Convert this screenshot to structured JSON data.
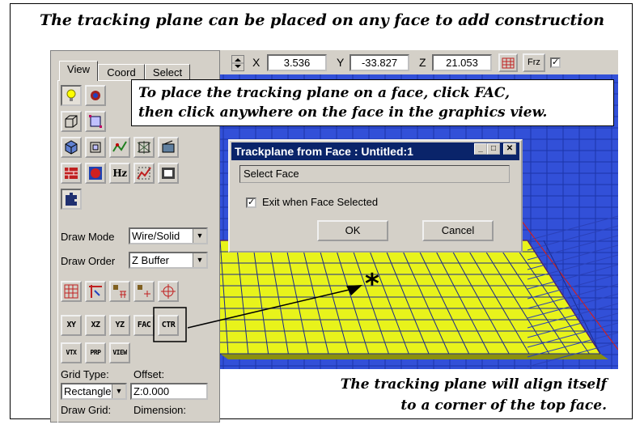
{
  "captions": {
    "top": "The tracking plane can be placed on any face to add construction",
    "callout_line1": "To place the tracking plane on a face, click FAC,",
    "callout_line2": "then click anywhere on the face in the graphics view.",
    "bottom_line1": "The tracking plane will align itself",
    "bottom_line2": "to a corner of the top face."
  },
  "panel": {
    "tabs": [
      "View",
      "Coord",
      "Select"
    ],
    "active_tab": "View",
    "icon_names": [
      "bulb-icon",
      "gear-ball-icon",
      "box-wire-icon",
      "box-select-icon",
      "cube-shaded-icon",
      "box-frame-icon",
      "curve-icon",
      "surface-icon",
      "camera-icon",
      "brick-icon",
      "sphere-icon",
      "hz-icon",
      "spray-icon",
      "b-icon",
      "puzzle-icon"
    ],
    "hz_label": "Hz",
    "draw_mode_label": "Draw Mode",
    "draw_mode_value": "Wire/Solid",
    "draw_order_label": "Draw Order",
    "draw_order_value": "Z Buffer",
    "plane_buttons": [
      "XY",
      "XZ",
      "YZ",
      "FAC",
      "CTR"
    ],
    "plane_buttons2": [
      "VTX",
      "PRP",
      "VIEW"
    ],
    "grid_type_label": "Grid Type:",
    "offset_label": "Offset:",
    "grid_type_value": "Rectangle",
    "offset_value": "Z:0.000",
    "draw_grid_label": "Draw Grid:",
    "dimension_label": "Dimension:"
  },
  "toolbar": {
    "x_label": "X",
    "x_value": "3.536",
    "y_label": "Y",
    "y_value": "-33.827",
    "z_label": "Z",
    "z_value": "21.053",
    "frz_label": "Frz"
  },
  "dialog": {
    "title": "Trackplane from Face : Untitled:1",
    "status": "Select Face",
    "checkbox_label": "Exit when Face Selected",
    "checked": true,
    "ok_label": "OK",
    "cancel_label": "Cancel"
  },
  "colors": {
    "face": "#e8f31b",
    "grid": "#1a2a8c",
    "background": "#3250d8",
    "title_bar": "#0a246a"
  }
}
